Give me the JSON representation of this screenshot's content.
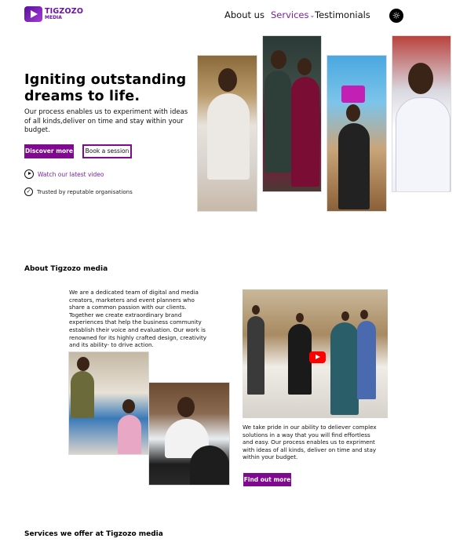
{
  "header": {
    "logo_name": "TIGZOZO",
    "logo_sub": "MEDIA",
    "nav": {
      "about": "About us",
      "services": "Services",
      "testimonials": "Testimonials"
    },
    "theme_icon": "sun-icon"
  },
  "hero": {
    "title": "Igniting outstanding dreams to life.",
    "description": "Our process enables us to experiment with ideas of all kinds,deliver on time and stay within your budget.",
    "primary_button": "Discover more",
    "secondary_button": "Book a session",
    "watch_link": "Watch our latest video",
    "trusted_text": "Trusted by reputable organisations"
  },
  "about": {
    "heading": "About Tigzozo media",
    "paragraph": "We are a dedicated team of digital and media creators, marketers and event planners who share a common passion with our clients. Together we create extraordinary brand experiences that help the business community establish their voice and evaluation. Our work is renowned for its highly crafted design, creativity and its ability- to drive action.",
    "pride_text": "We take pride in our ability to deliever complex solutions in a way that you will find effortless and easy. Our process enables us to expriment with ideas of all kinds, deliver on time and stay within your budget.",
    "button": "Find out more"
  },
  "services": {
    "heading": "Services we offer at Tigzozo media"
  },
  "colors": {
    "brand": "#800a8f",
    "accent_text": "#7e1fa6"
  }
}
